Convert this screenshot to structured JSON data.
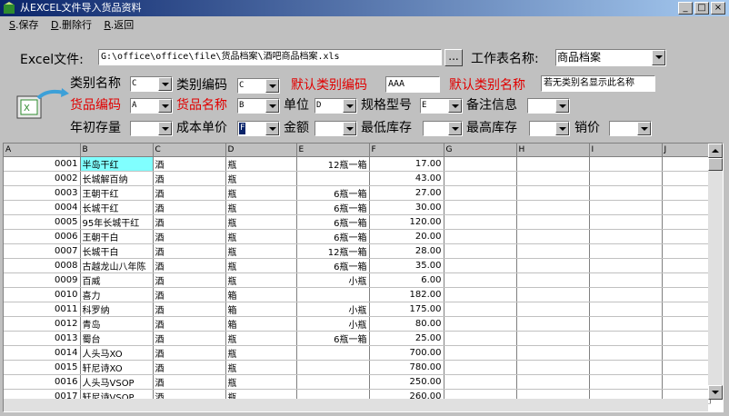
{
  "window": {
    "title": "从EXCEL文件导入货品资料",
    "min": "_",
    "max": "□",
    "close": "×"
  },
  "menu": [
    {
      "key": "S",
      "label": ".保存"
    },
    {
      "key": "D",
      "label": ".删除行"
    },
    {
      "key": "R",
      "label": ".返回"
    }
  ],
  "form": {
    "excel_label": "Excel文件:",
    "excel_path": "G:\\office\\office\\file\\货品档案\\酒吧商品档案.xls",
    "browse": "...",
    "sheet_label": "工作表名称:",
    "sheet_value": "商品档案",
    "category_name_label": "类别名称",
    "category_name_col": "C",
    "category_code_label": "类别编码",
    "category_code_col": "C",
    "default_code_label": "默认类别编码",
    "default_code_value": "AAA",
    "default_name_label": "默认类别名称",
    "default_name_value": "若无类别名显示此名称",
    "item_code_label": "货品编码",
    "item_code_col": "A",
    "item_name_label": "货品名称",
    "item_name_col": "B",
    "unit_label": "单位",
    "unit_col": "D",
    "spec_label": "规格型号",
    "spec_col": "E",
    "remark_label": "备注信息",
    "remark_col": "",
    "opening_label": "年初存量",
    "opening_col": "",
    "cost_label": "成本单价",
    "cost_col": "F",
    "amount_label": "金额",
    "amount_col": "",
    "min_stock_label": "最低库存",
    "min_stock_col": "",
    "max_stock_label": "最高库存",
    "max_stock_col": "",
    "price_label": "销价",
    "price_col": ""
  },
  "grid": {
    "columns": [
      "A",
      "B",
      "C",
      "D",
      "E",
      "F",
      "G",
      "H",
      "I",
      "J"
    ],
    "rows": [
      [
        "0001",
        "半岛干红",
        "酒",
        "瓶",
        "12瓶一箱",
        "17.00"
      ],
      [
        "0002",
        "长城解百纳",
        "酒",
        "瓶",
        "",
        "43.00"
      ],
      [
        "0003",
        "王朝干红",
        "酒",
        "瓶",
        "6瓶一箱",
        "27.00"
      ],
      [
        "0004",
        "长城干红",
        "酒",
        "瓶",
        "6瓶一箱",
        "30.00"
      ],
      [
        "0005",
        "95年长城干红",
        "酒",
        "瓶",
        "6瓶一箱",
        "120.00"
      ],
      [
        "0006",
        "王朝干白",
        "酒",
        "瓶",
        "6瓶一箱",
        "20.00"
      ],
      [
        "0007",
        "长城干白",
        "酒",
        "瓶",
        "12瓶一箱",
        "28.00"
      ],
      [
        "0008",
        "古越龙山八年陈",
        "酒",
        "瓶",
        "6瓶一箱",
        "35.00"
      ],
      [
        "0009",
        "百威",
        "酒",
        "瓶",
        "小瓶",
        "6.00"
      ],
      [
        "0010",
        "喜力",
        "酒",
        "箱",
        "",
        "182.00"
      ],
      [
        "0011",
        "科罗纳",
        "酒",
        "箱",
        "小瓶",
        "175.00"
      ],
      [
        "0012",
        "青岛",
        "酒",
        "箱",
        "小瓶",
        "80.00"
      ],
      [
        "0013",
        "蜀台",
        "酒",
        "瓶",
        "6瓶一箱",
        "25.00"
      ],
      [
        "0014",
        "人头马XO",
        "酒",
        "瓶",
        "",
        "700.00"
      ],
      [
        "0015",
        "轩尼诗XO",
        "酒",
        "瓶",
        "",
        "780.00"
      ],
      [
        "0016",
        "人头马VSOP",
        "酒",
        "瓶",
        "",
        "250.00"
      ],
      [
        "0017",
        "轩尼诗VSOP",
        "酒",
        "瓶",
        "",
        "260.00"
      ]
    ]
  }
}
